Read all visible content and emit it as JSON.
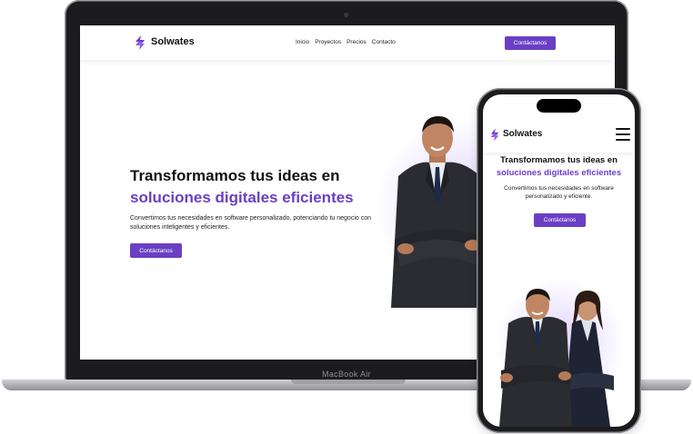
{
  "colors": {
    "accent": "#6b3fc4",
    "text": "#111111",
    "frame": "#1c1c1e"
  },
  "laptop": {
    "bezel_label": "MacBook Air",
    "brand": "Solwates",
    "logo_icon": "lightning-s-icon",
    "nav": [
      "Inicio",
      "Proyectos",
      "Precios",
      "Contacto"
    ],
    "nav_cta": "Contáctanos",
    "hero_title": "Transformamos tus ideas en",
    "hero_accent": "soluciones digitales eficientes",
    "hero_description": "Convertimos tus necesidades en software personalizado, potenciando tu negocio con soluciones inteligentes y eficientes.",
    "hero_cta": "Contáctanos"
  },
  "phone": {
    "brand": "Solwates",
    "logo_icon": "lightning-s-icon",
    "menu_icon": "hamburger-menu-icon",
    "hero_title": "Transformamos tus ideas en",
    "hero_accent": "soluciones digitales eficientes",
    "hero_description": "Convertimos tus necesidades en software personalizado y eficiente.",
    "hero_cta": "Contáctanos"
  }
}
